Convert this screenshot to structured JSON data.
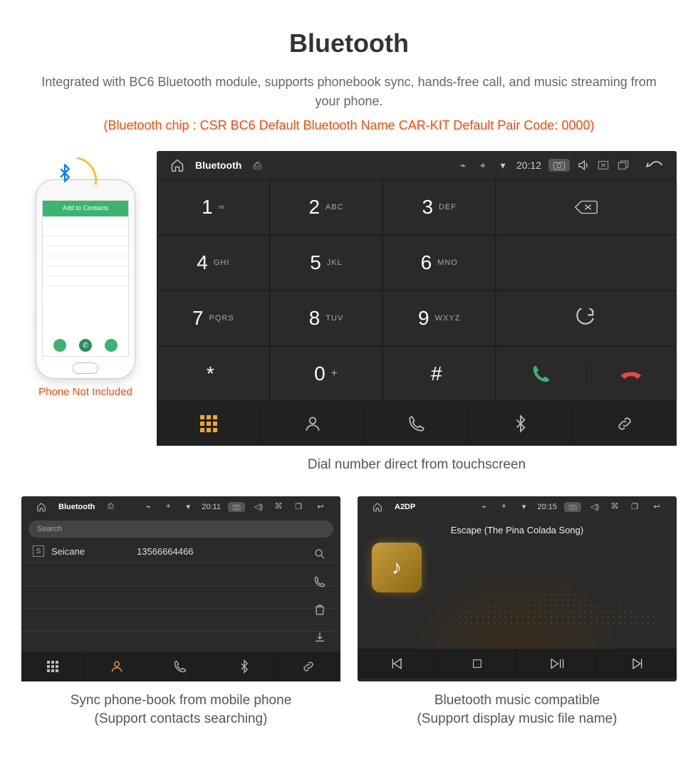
{
  "title": "Bluetooth",
  "subtitle": "Integrated with BC6 Bluetooth module, supports phonebook sync, hands-free call, and music streaming from your phone.",
  "specs": "(Bluetooth chip : CSR BC6    Default Bluetooth Name CAR-KIT    Default Pair Code: 0000)",
  "phone_note": "Phone Not Included",
  "phone_screen": {
    "header": "Add to Contacts"
  },
  "captions": {
    "dialer": "Dial number direct from touchscreen",
    "phonebook_l1": "Sync phone-book from mobile phone",
    "phonebook_l2": "(Support contacts searching)",
    "music_l1": "Bluetooth music compatible",
    "music_l2": "(Support display music file name)"
  },
  "dialer": {
    "status_title": "Bluetooth",
    "time": "20:12",
    "keys": [
      {
        "num": "1",
        "sub": "∞"
      },
      {
        "num": "2",
        "sub": "ABC"
      },
      {
        "num": "3",
        "sub": "DEF"
      },
      {
        "num": "4",
        "sub": "GHI"
      },
      {
        "num": "5",
        "sub": "JKL"
      },
      {
        "num": "6",
        "sub": "MNO"
      },
      {
        "num": "7",
        "sub": "PQRS"
      },
      {
        "num": "8",
        "sub": "TUV"
      },
      {
        "num": "9",
        "sub": "WXYZ"
      },
      {
        "num": "*",
        "sub": ""
      },
      {
        "num": "0",
        "sub": "+"
      },
      {
        "num": "#",
        "sub": ""
      }
    ]
  },
  "phonebook": {
    "status_title": "Bluetooth",
    "time": "20:11",
    "search_placeholder": "Search",
    "contact_tag": "S",
    "contact_name": "Seicane",
    "contact_number": "13566664466"
  },
  "music": {
    "status_title": "A2DP",
    "time": "20:15",
    "song": "Escape (The Pina Colada Song)"
  }
}
